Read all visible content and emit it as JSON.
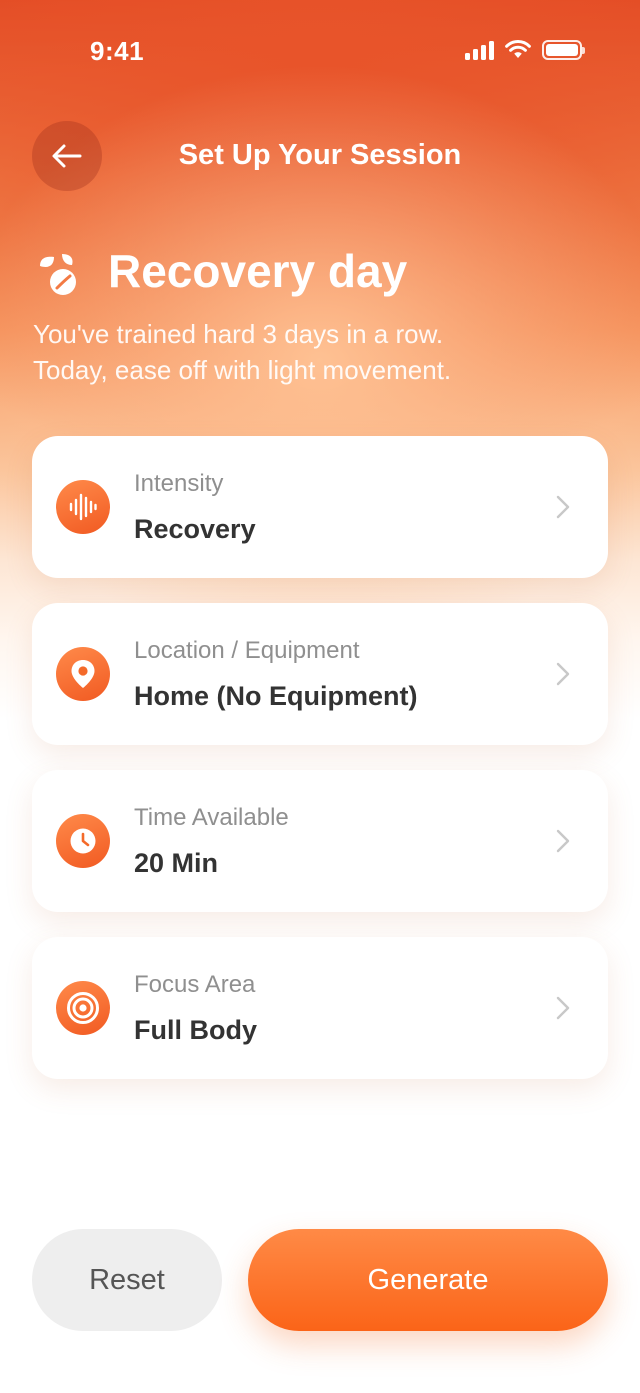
{
  "status_bar": {
    "time": "9:41"
  },
  "header": {
    "title": "Set Up Your Session"
  },
  "hero": {
    "title": "Recovery day",
    "subtitle_line1": "You've trained hard 3 days in a row.",
    "subtitle_line2": "Today, ease off with light movement."
  },
  "options": [
    {
      "label": "Intensity",
      "value": "Recovery",
      "icon": "soundwave-icon"
    },
    {
      "label": "Location / Equipment",
      "value": "Home (No Equipment)",
      "icon": "location-pin-icon"
    },
    {
      "label": "Time Available",
      "value": "20 Min",
      "icon": "clock-icon"
    },
    {
      "label": "Focus Area",
      "value": "Full Body",
      "icon": "target-icon"
    }
  ],
  "actions": {
    "reset_label": "Reset",
    "generate_label": "Generate"
  },
  "colors": {
    "accent": "#F96A22",
    "accent_light": "#FF8A46",
    "header_bg": "#E24A24",
    "muted_button": "#EEEEEE"
  }
}
